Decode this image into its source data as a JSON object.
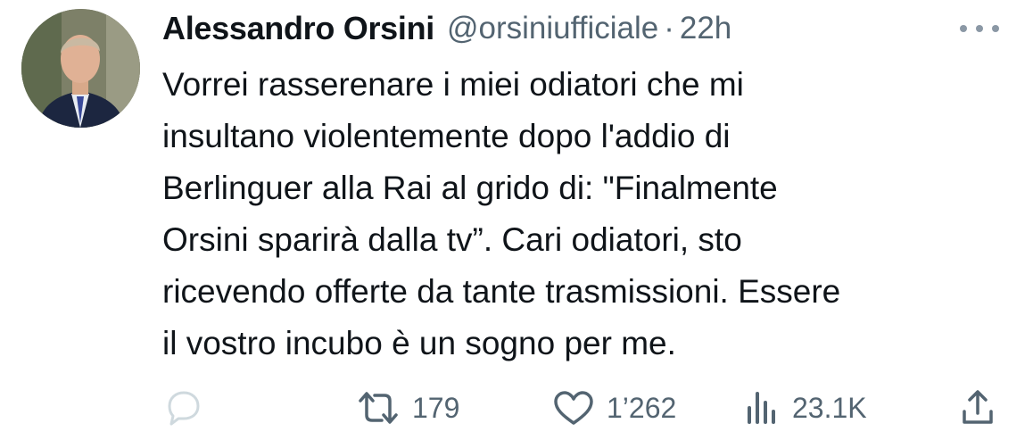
{
  "tweet": {
    "author": {
      "display_name": "Alessandro Orsini",
      "handle": "@orsiniufficiale"
    },
    "separator": "·",
    "time": "22h",
    "text": "Vorrei rasserenare i miei odiatori che mi\ninsultano violentemente dopo l'addio di\nBerlinguer alla Rai al grido di: \"Finalmente\nOrsini sparirà dalla tv”. Cari odiatori, sto\nricevendo offerte da tante trasmissioni. Essere\nil vostro incubo è un sogno per me.",
    "metrics": {
      "retweets": "179",
      "likes": "1’262",
      "views": "23.1K"
    }
  },
  "icons": {
    "more": "more-dots-icon",
    "reply": "reply-icon",
    "retweet": "retweet-icon",
    "like": "heart-icon",
    "views": "views-bar-chart-icon",
    "share": "share-icon"
  },
  "colors": {
    "text": "#0f1419",
    "secondary": "#536471"
  }
}
